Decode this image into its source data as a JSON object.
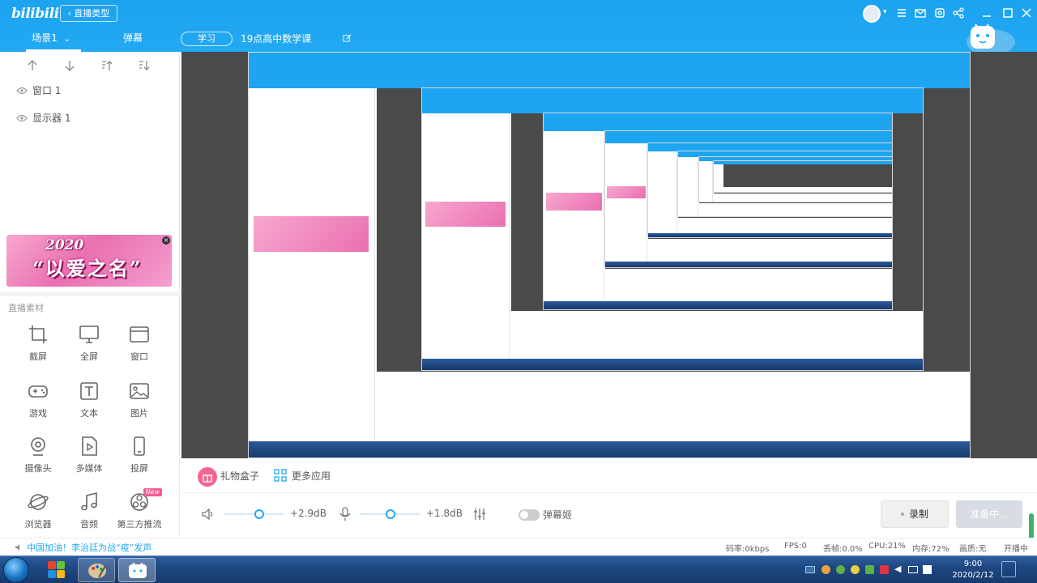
{
  "app": {
    "logo": "bilibili",
    "back_button": "直播类型",
    "scene_tab": "场景1",
    "danmaku_tab": "弹幕",
    "category": "学习",
    "room_title": "19点高中数学课"
  },
  "sources": [
    {
      "label": "窗口 1"
    },
    {
      "label": "显示器 1"
    }
  ],
  "banner": {
    "year": "2020",
    "text": "“以爱之名”"
  },
  "materials": {
    "title": "直播素材",
    "items": [
      {
        "label": "截屏",
        "icon": "crop-icon"
      },
      {
        "label": "全屏",
        "icon": "monitor-icon"
      },
      {
        "label": "窗口",
        "icon": "window-icon"
      },
      {
        "label": "游戏",
        "icon": "gamepad-icon"
      },
      {
        "label": "文本",
        "icon": "text-icon"
      },
      {
        "label": "图片",
        "icon": "image-icon"
      },
      {
        "label": "摄像头",
        "icon": "camera-icon"
      },
      {
        "label": "多媒体",
        "icon": "media-icon"
      },
      {
        "label": "投屏",
        "icon": "phone-icon"
      },
      {
        "label": "浏览器",
        "icon": "browser-icon"
      },
      {
        "label": "音频",
        "icon": "music-icon"
      },
      {
        "label": "第三方推流",
        "icon": "obs-icon",
        "badge": "New"
      }
    ]
  },
  "bottom": {
    "gift_box": "礼物盒子",
    "more_apps": "更多应用",
    "speaker_volume": "+2.9dB",
    "mic_volume": "+1.8dB",
    "danmaku_toggle": "弹幕姬",
    "record_button": "录制",
    "ready_button": "准备中..."
  },
  "status": {
    "news": "中国加油！李治廷为战“疫”发声",
    "bitrate": "码率:0kbps",
    "fps": "FPS:0",
    "dropped": "丢帧:0.0%",
    "cpu": "CPU:21%",
    "memory": "内存:72%",
    "quality": "画质:无",
    "live_state": "开播中"
  },
  "taskbar": {
    "time": "9:00",
    "date": "2020/2/12"
  },
  "colors": {
    "brand_blue": "#23a9f2",
    "pink": "#f2668f",
    "taskbar": "#1f4883"
  }
}
